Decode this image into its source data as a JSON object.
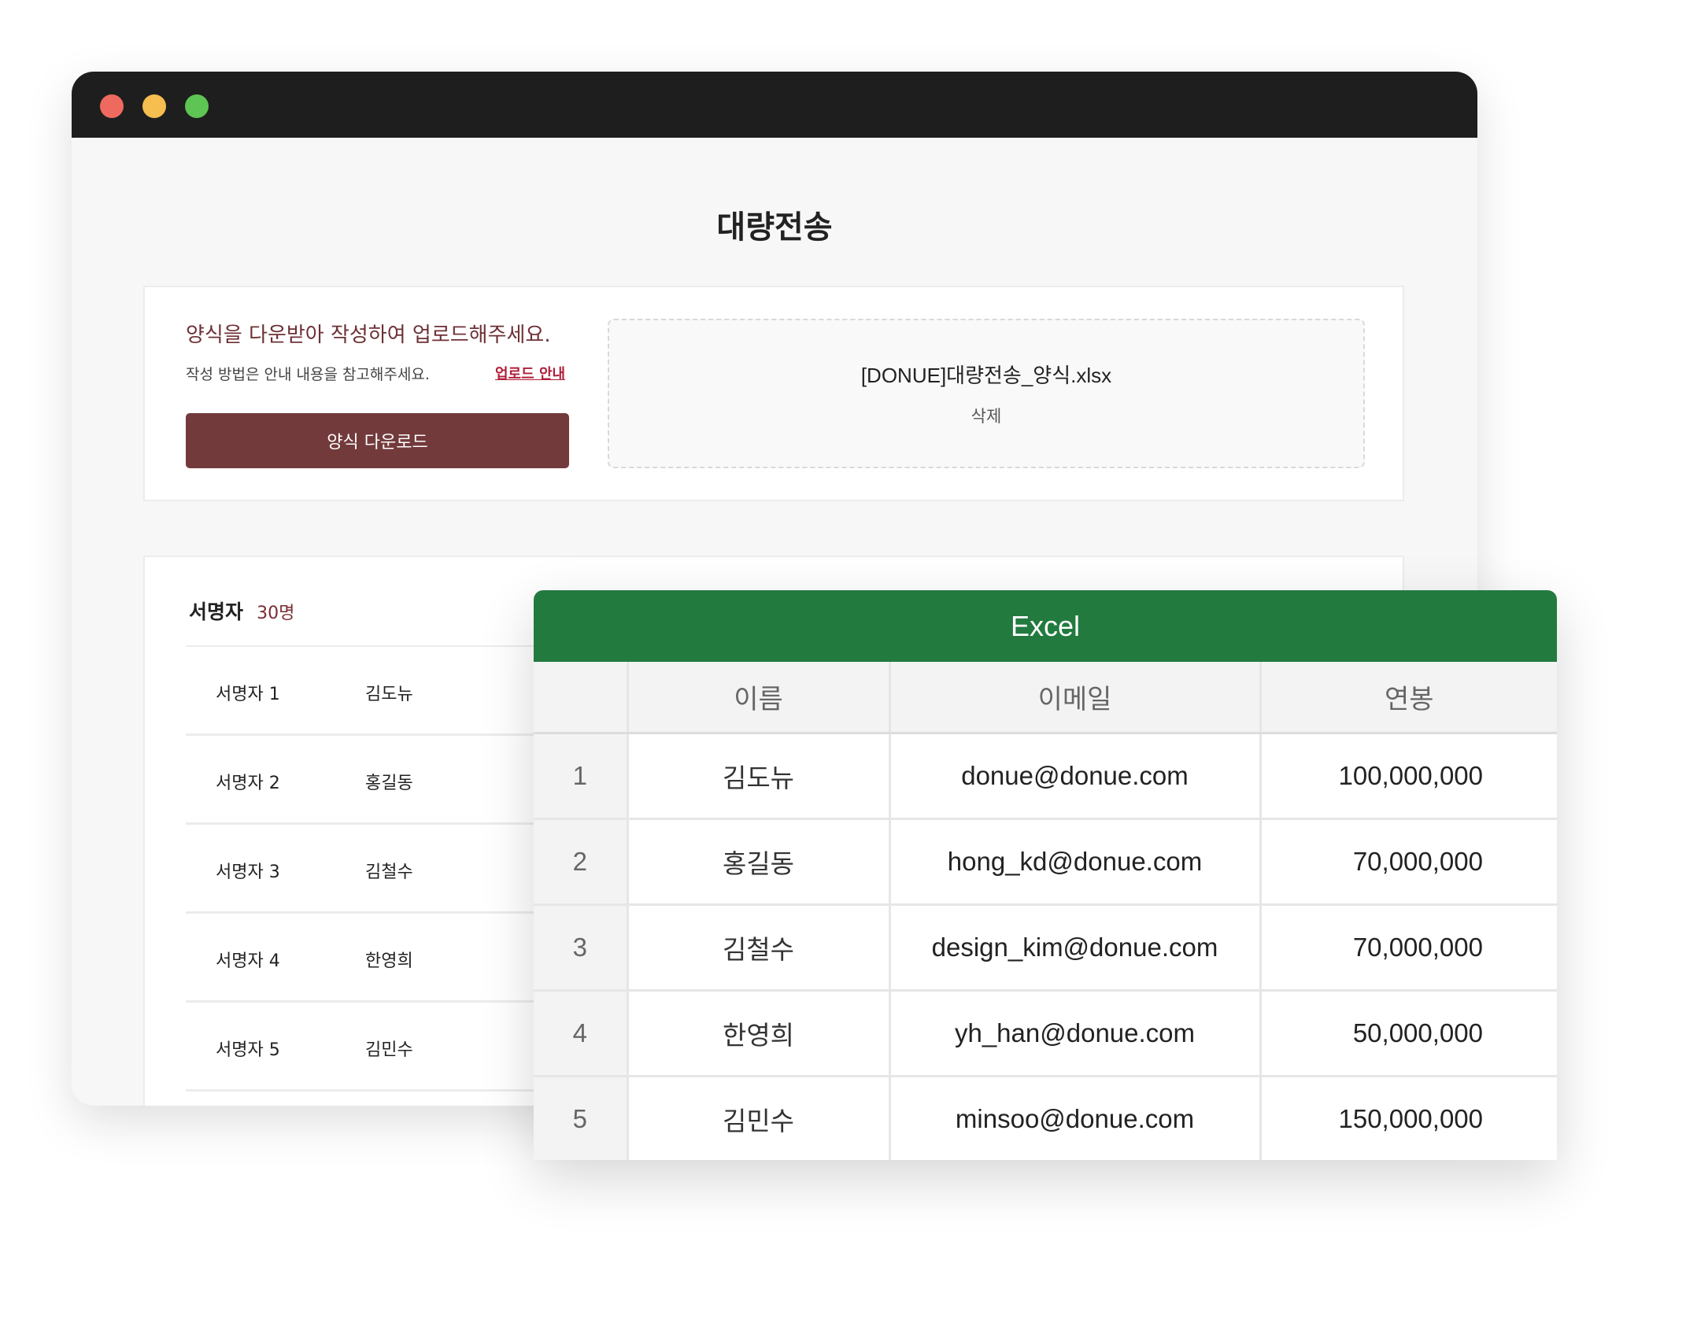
{
  "window": {
    "title": "대량전송"
  },
  "upload": {
    "headline": "양식을 다운받아 작성하여 업로드해주세요.",
    "subtext": "작성 방법은 안내 내용을 참고해주세요.",
    "guide_link": "업로드 안내",
    "download_button": "양식 다운로드",
    "file_name": "[DONUE]대량전송_양식.xlsx",
    "delete_label": "삭제"
  },
  "signers": {
    "title": "서명자",
    "count": "30명",
    "rows": [
      {
        "label": "서명자 1",
        "name": "김도뉴"
      },
      {
        "label": "서명자 2",
        "name": "홍길동"
      },
      {
        "label": "서명자 3",
        "name": "김철수"
      },
      {
        "label": "서명자 4",
        "name": "한영희"
      },
      {
        "label": "서명자 5",
        "name": "김민수"
      }
    ]
  },
  "excel": {
    "title": "Excel",
    "columns": [
      "",
      "이름",
      "이메일",
      "연봉"
    ],
    "rows": [
      {
        "num": "1",
        "name": "김도뉴",
        "email": "donue@donue.com",
        "salary": "100,000,000"
      },
      {
        "num": "2",
        "name": "홍길동",
        "email": "hong_kd@donue.com",
        "salary": "70,000,000"
      },
      {
        "num": "3",
        "name": "김철수",
        "email": "design_kim@donue.com",
        "salary": "70,000,000"
      },
      {
        "num": "4",
        "name": "한영희",
        "email": "yh_han@donue.com",
        "salary": "50,000,000"
      },
      {
        "num": "5",
        "name": "김민수",
        "email": "minsoo@donue.com",
        "salary": "150,000,000"
      }
    ]
  },
  "colors": {
    "brand": "#733a3c",
    "excel_green": "#227a3f",
    "link_red": "#b01e3a"
  }
}
